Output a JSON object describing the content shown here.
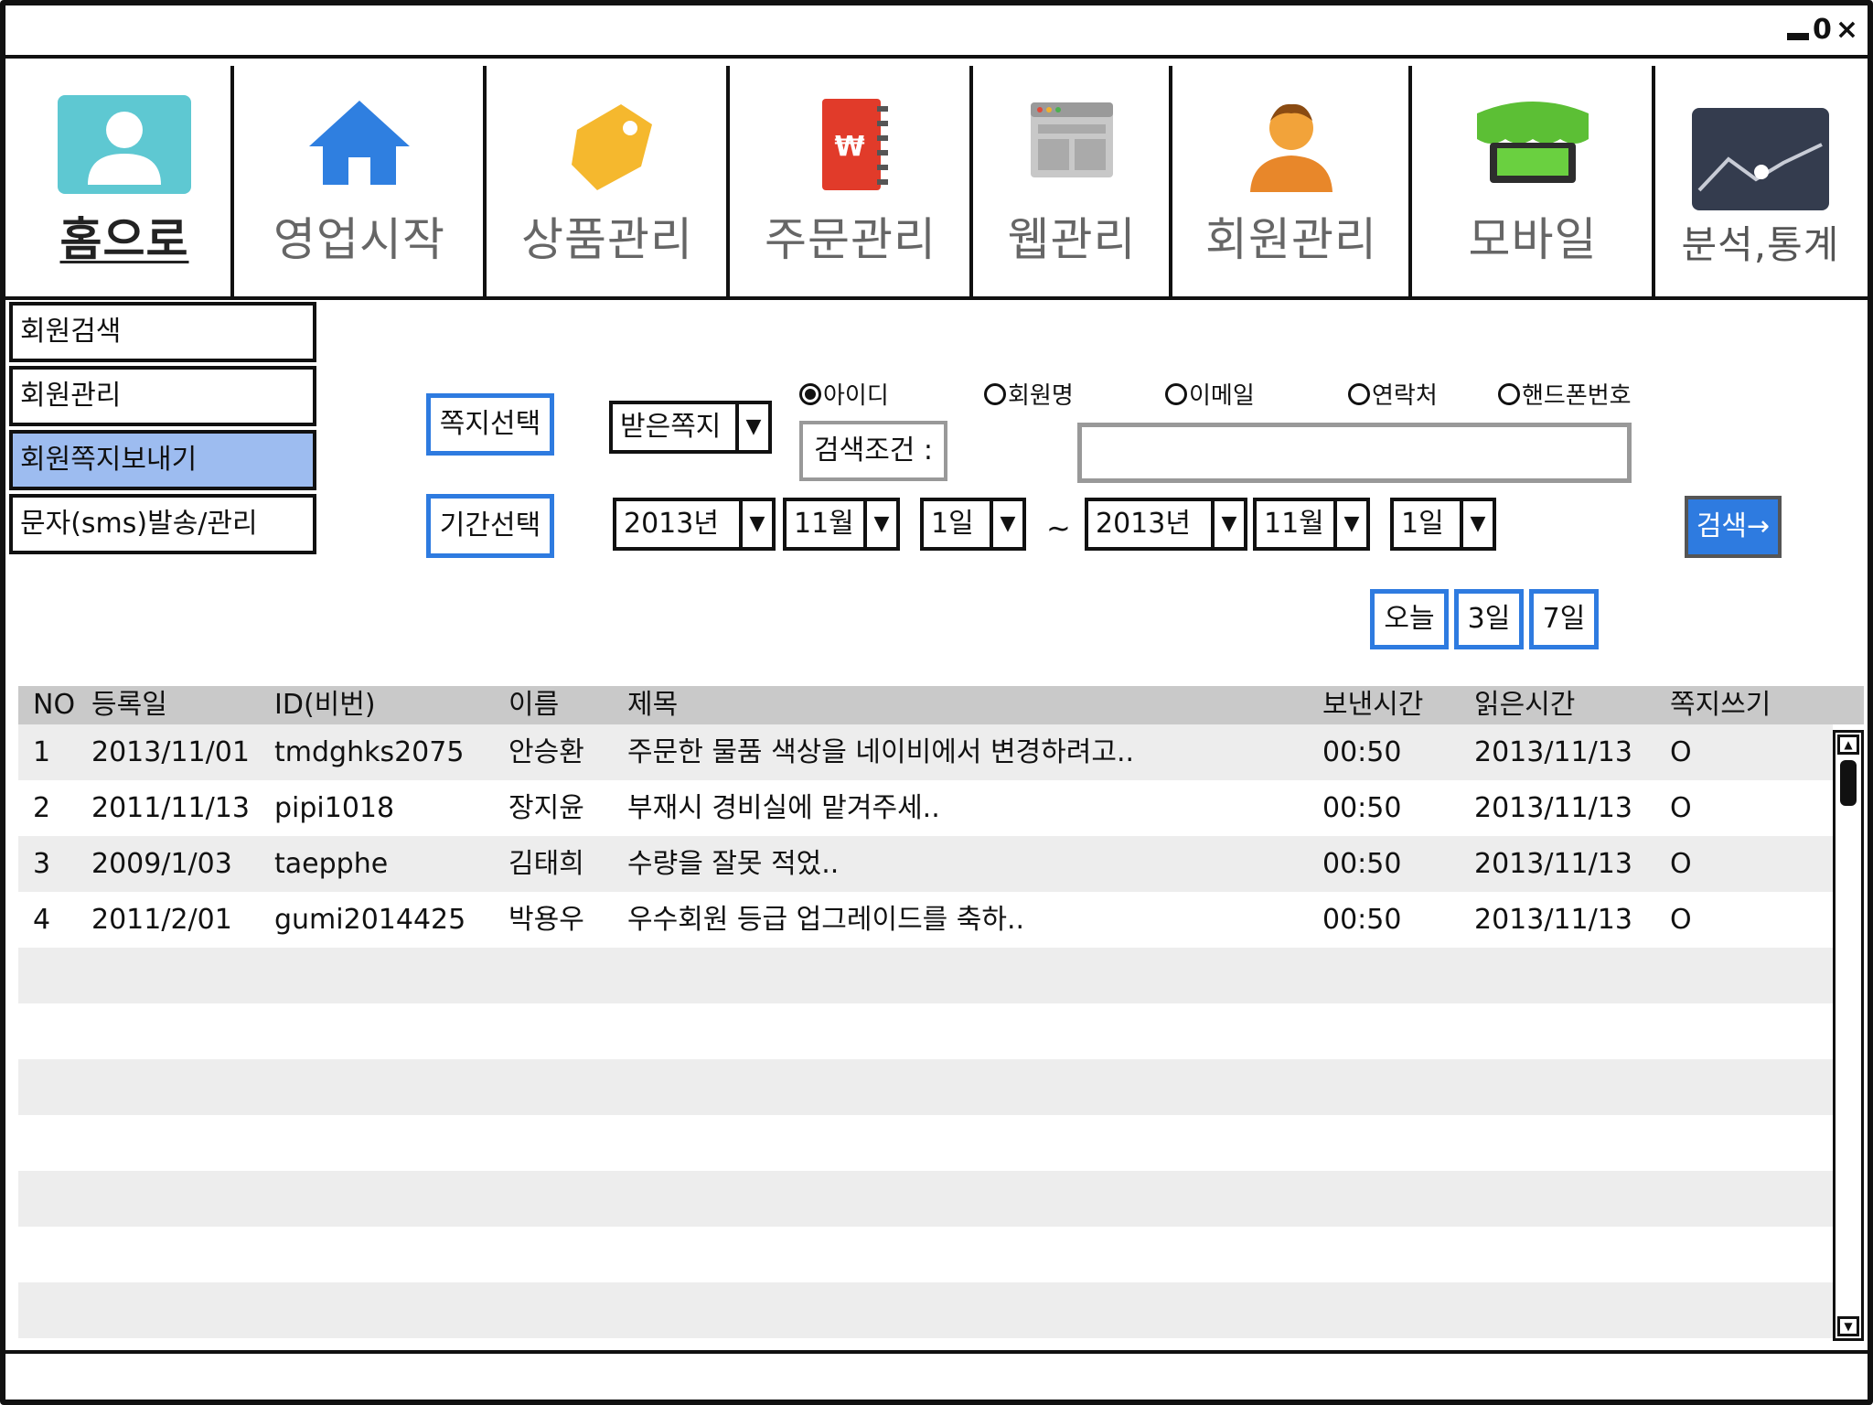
{
  "window": {
    "controls": {
      "minimize": "_",
      "maximize": "0",
      "close": "×"
    }
  },
  "top_menu": [
    {
      "label": "홈으로",
      "icon": "user-icon"
    },
    {
      "label": "영업시작",
      "icon": "home-icon"
    },
    {
      "label": "상품관리",
      "icon": "tag-icon"
    },
    {
      "label": "주문관리",
      "icon": "notebook-icon"
    },
    {
      "label": "웹관리",
      "icon": "browser-window-icon"
    },
    {
      "label": "회원관리",
      "icon": "person-icon"
    },
    {
      "label": "모바일",
      "icon": "store-icon"
    },
    {
      "label": "분석,통계",
      "icon": "chart-icon"
    }
  ],
  "sub_menu": [
    {
      "label": "회원검색",
      "active": false
    },
    {
      "label": "회원관리",
      "active": false
    },
    {
      "label": "회원쪽지보내기",
      "active": true
    },
    {
      "label": "문자(sms)발송/관리",
      "active": false
    }
  ],
  "filters": {
    "message_select_label": "쪽지선택",
    "message_type_value": "받은쪽지",
    "period_select_label": "기간선택",
    "search_condition_label": "검색조건 :",
    "search_value": "",
    "radio_options": [
      {
        "label": "아이디",
        "selected": true
      },
      {
        "label": "회원명",
        "selected": false
      },
      {
        "label": "이메일",
        "selected": false
      },
      {
        "label": "연락처",
        "selected": false
      },
      {
        "label": "핸드폰번호",
        "selected": false
      }
    ],
    "from": {
      "year": "2013년",
      "month": "11월",
      "day": "1일"
    },
    "to": {
      "year": "2013년",
      "month": "11월",
      "day": "1일"
    },
    "tilde": "~",
    "search_button": "검색→",
    "quick_ranges": [
      "오늘",
      "3일",
      "7일"
    ]
  },
  "table": {
    "headers": [
      "NO",
      "등록일",
      "ID(비번)",
      "이름",
      "제목",
      "보낸시간",
      "읽은시간",
      "쪽지쓰기"
    ],
    "rows": [
      [
        "1",
        "2013/11/01",
        "tmdghks2075",
        "안승환",
        "주문한 물품 색상을 네이비에서 변경하려고..",
        "00:50",
        "2013/11/13",
        "O"
      ],
      [
        "2",
        "2011/11/13",
        "pipi1018",
        "장지윤",
        "부재시 경비실에 맡겨주세..",
        "00:50",
        "2013/11/13",
        "O"
      ],
      [
        "3",
        "2009/1/03",
        "taepphe",
        "김태희",
        "수량을 잘못 적었..",
        "00:50",
        "2013/11/13",
        "O"
      ],
      [
        "4",
        "2011/2/01",
        "gumi2014425",
        "박용우",
        "우수회원 등급 업그레이드를 축하..",
        "00:50",
        "2013/11/13",
        "O"
      ]
    ],
    "empty_rows": 7
  },
  "colors": {
    "accent_blue": "#2e7be0",
    "active_submenu": "#9dbcf0",
    "table_header": "#c9c9c9",
    "row_stripe": "#ededed"
  }
}
